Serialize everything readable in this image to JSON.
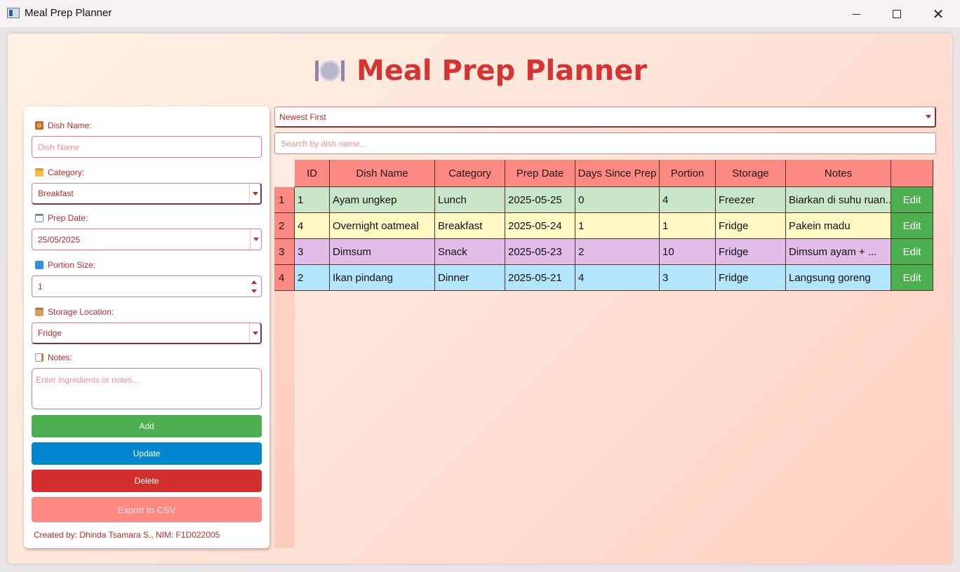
{
  "window": {
    "title": "Meal Prep Planner"
  },
  "header": {
    "title": "Meal Prep Planner",
    "icon": "plate-with-cutlery-icon"
  },
  "form": {
    "dish_name": {
      "label": "Dish Name:",
      "placeholder": "Dish Name",
      "value": ""
    },
    "category": {
      "label": "Category:",
      "value": "Breakfast"
    },
    "prep_date": {
      "label": "Prep Date:",
      "value": "25/05/2025"
    },
    "portion_size": {
      "label": "Portion Size:",
      "value": "1"
    },
    "storage_location": {
      "label": "Storage Location:",
      "value": "Fridge"
    },
    "notes": {
      "label": "Notes:",
      "placeholder": "Enter ingredients or notes..."
    },
    "buttons": {
      "add": "Add",
      "update": "Update",
      "delete": "Delete",
      "export": "Export to CSV"
    },
    "credit": "Created by: Dhinda Tsamara S., NIM: F1D022005"
  },
  "sort": {
    "value": "Newest First"
  },
  "search": {
    "placeholder": "Search by dish name..."
  },
  "table": {
    "columns": [
      "ID",
      "Dish Name",
      "Category",
      "Prep Date",
      "Days Since Prep",
      "Portion",
      "Storage",
      "Notes",
      ""
    ],
    "edit_label": "Edit",
    "rows": [
      {
        "num": "1",
        "id": "1",
        "dish": "Ayam ungkep",
        "category": "Lunch",
        "prep_date": "2025-05-25",
        "days": "0",
        "portion": "4",
        "storage": "Freezer",
        "notes": "Biarkan di suhu ruan...",
        "color": "#c8e6c9"
      },
      {
        "num": "2",
        "id": "4",
        "dish": "Overnight oatmeal",
        "category": "Breakfast",
        "prep_date": "2025-05-24",
        "days": "1",
        "portion": "1",
        "storage": "Fridge",
        "notes": "Pakein madu",
        "color": "#fff9c4"
      },
      {
        "num": "3",
        "id": "3",
        "dish": "Dimsum",
        "category": "Snack",
        "prep_date": "2025-05-23",
        "days": "2",
        "portion": "10",
        "storage": "Fridge",
        "notes": "Dimsum ayam + ...",
        "color": "#e1bee7"
      },
      {
        "num": "4",
        "id": "2",
        "dish": "Ikan pindang",
        "category": "Dinner",
        "prep_date": "2025-05-21",
        "days": "4",
        "portion": "3",
        "storage": "Fridge",
        "notes": "Langsung goreng",
        "color": "#b3e5fc"
      }
    ]
  },
  "colors": {
    "accent": "#d63333",
    "header_cell": "#fa8a82",
    "add": "#4caf50",
    "update": "#0286cf",
    "delete": "#d32f2f",
    "export": "#fa8a82"
  }
}
